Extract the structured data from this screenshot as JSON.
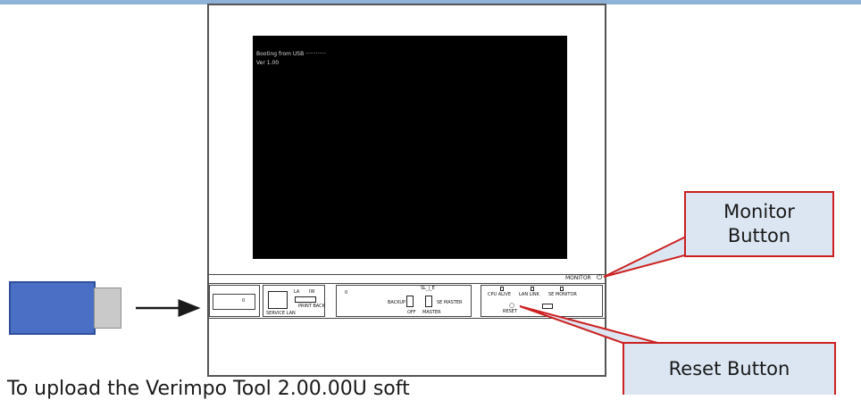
{
  "screen": {
    "line1": "Booting from USB ············",
    "line2": "Ver 1.00"
  },
  "panel": {
    "monitor_label": "MONITOR",
    "service_lan_label": "SERVICE LAN",
    "la_label": "LA",
    "iw_label": "IW",
    "print_back_label": "PRINT BACK",
    "backup_label": "BACKUP",
    "off_label": "OFF",
    "sl_e_label": "SL_|_E",
    "master_label": "MASTER",
    "se_master_label": "SE MASTER",
    "cpu_alive_label": "CPU ALIVE",
    "lan_link_label": "LAN LINK",
    "se_monitor_label": "SE MONITOR",
    "reset_label": "RESET"
  },
  "callouts": {
    "monitor_button": [
      "Monitor",
      "Button"
    ],
    "reset_button": "Reset Button"
  },
  "caption": "To upload the Verimpo Tool 2.00.00U soft",
  "colors": {
    "callout_fill": "#dce6f2",
    "callout_border": "#cc1f1f",
    "usb_blue": "#4a6fc4",
    "top_bar": "#8fb3d6"
  }
}
